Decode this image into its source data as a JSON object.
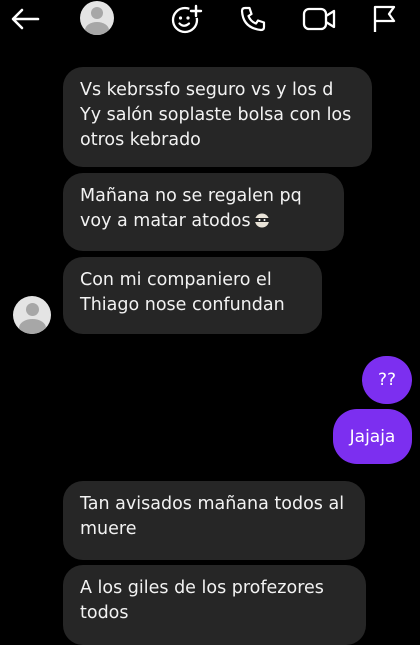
{
  "header": {
    "icons": [
      "back-arrow-icon",
      "contact-avatar-icon",
      "add-effect-icon",
      "phone-call-icon",
      "video-call-icon",
      "report-flag-icon"
    ]
  },
  "messages": [
    {
      "side": "in",
      "text": "Vs kebrssfo seguro vs y los d Yy salón soplaste bolsa con los otros kebrado"
    },
    {
      "side": "in",
      "text": "Mañana no se regalen pq voy a matar atodos",
      "emoji": "ninja-face-emoji"
    },
    {
      "side": "in",
      "text": "Con mi companiero el Thiago nose confundan"
    },
    {
      "side": "out",
      "text": "??"
    },
    {
      "side": "out",
      "text": "Jajaja"
    },
    {
      "side": "in",
      "text": "Tan avisados mañana todos al muere"
    },
    {
      "side": "in",
      "text": "A los giles de los profezores todos"
    }
  ],
  "colors": {
    "background": "#000000",
    "incoming_bubble": "#262626",
    "outgoing_bubble": "#7c2ff0",
    "text": "#ffffff"
  }
}
